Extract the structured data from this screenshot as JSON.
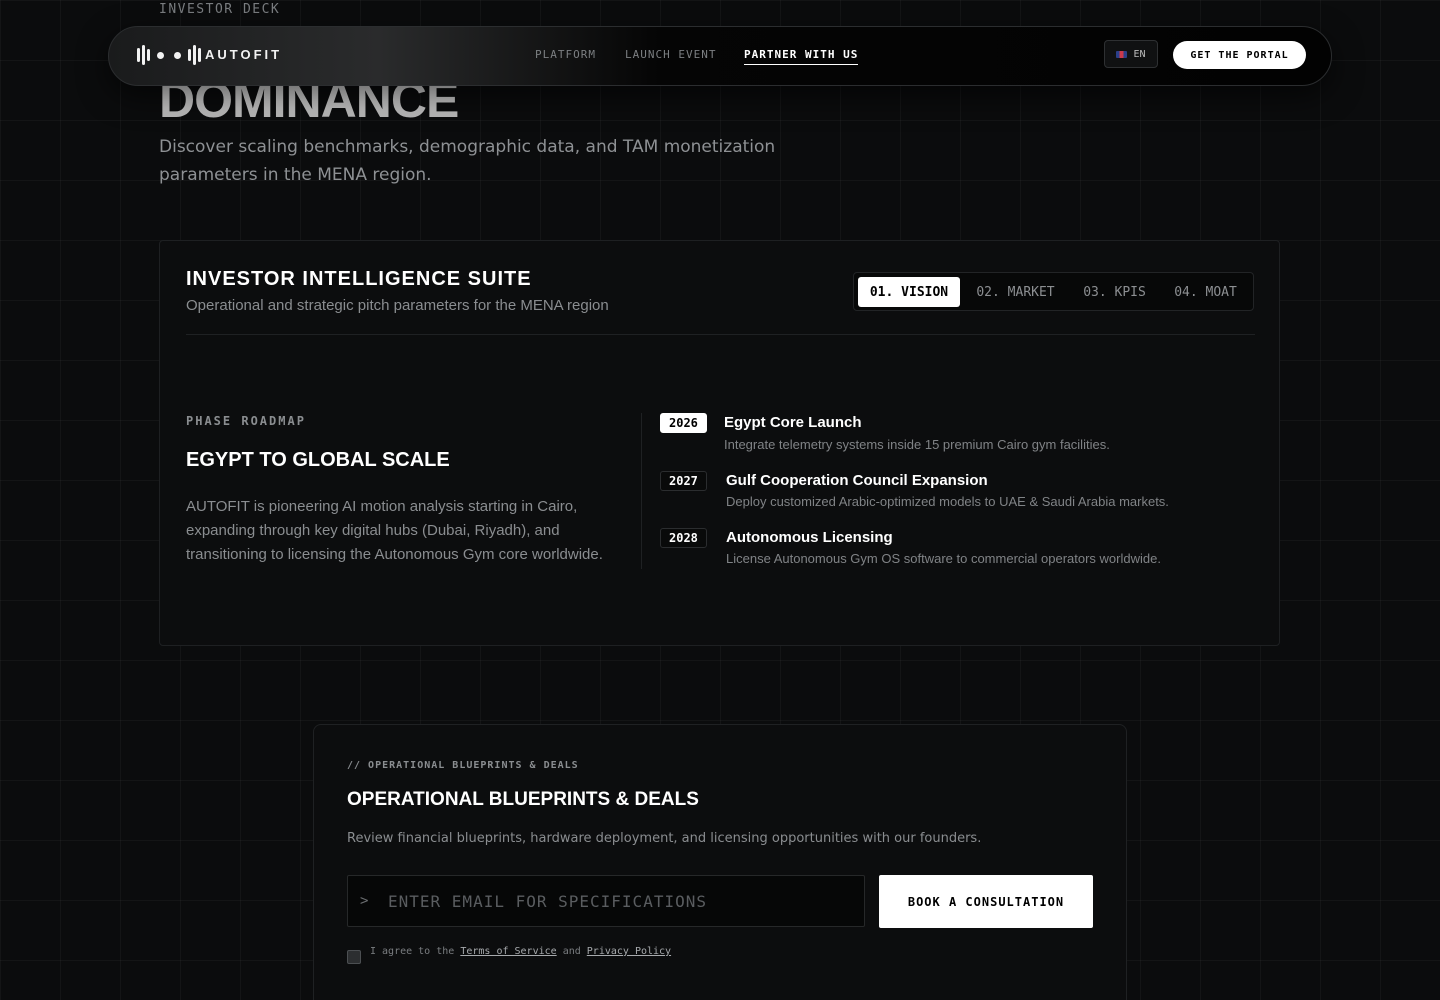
{
  "hero": {
    "eyebrow": "INVESTOR DECK",
    "title": "DOMINANCE",
    "subtitle": "Discover scaling benchmarks, demographic data, and TAM monetization parameters in the MENA region."
  },
  "nav": {
    "logo_text": "AUTOFIT",
    "logo_icon": "waveform-logo-icon",
    "links": [
      {
        "label": "PLATFORM"
      },
      {
        "label": "LAUNCH EVENT"
      },
      {
        "label": "PARTNER WITH US",
        "active": true
      }
    ],
    "language": {
      "label": "EN",
      "icon": "uk-flag-icon"
    },
    "portal_button": "GET THE PORTAL"
  },
  "suite": {
    "title": "INVESTOR INTELLIGENCE SUITE",
    "subtitle": "Operational and strategic pitch parameters for the MENA region",
    "tabs": [
      {
        "label": "01. VISION",
        "active": true
      },
      {
        "label": "02. MARKET"
      },
      {
        "label": "03. KPIS"
      },
      {
        "label": "04. MOAT"
      }
    ],
    "phase": {
      "label": "PHASE ROADMAP",
      "title": "EGYPT TO GLOBAL SCALE",
      "description": "AUTOFIT is pioneering AI motion analysis starting in Cairo, expanding through key digital hubs (Dubai, Riyadh), and transitioning to licensing the Autonomous Gym core worldwide."
    },
    "milestones": [
      {
        "year": "2026",
        "title": "Egypt Core Launch",
        "desc": "Integrate telemetry systems inside 15 premium Cairo gym facilities.",
        "active": true
      },
      {
        "year": "2027",
        "title": "Gulf Cooperation Council Expansion",
        "desc": "Deploy customized Arabic-optimized models to UAE & Saudi Arabia markets."
      },
      {
        "year": "2028",
        "title": "Autonomous Licensing",
        "desc": "License Autonomous Gym OS software to commercial operators worldwide."
      }
    ]
  },
  "cta": {
    "eyebrow": "// OPERATIONAL BLUEPRINTS & DEALS",
    "title": "OPERATIONAL BLUEPRINTS & DEALS",
    "subtitle": "Review financial blueprints, hardware deployment, and licensing opportunities with our founders.",
    "email_prompt": ">",
    "email_value": "",
    "email_placeholder": "ENTER EMAIL FOR SPECIFICATIONS",
    "button": "BOOK A CONSULTATION",
    "consent": {
      "prefix": "I agree to the",
      "terms": "Terms of Service",
      "and": "and",
      "privacy": "Privacy Policy",
      "checked": false
    }
  },
  "colors": {
    "background": "#0b0c0d",
    "accent": "#ffffff",
    "muted_text": "#8a8d90"
  }
}
